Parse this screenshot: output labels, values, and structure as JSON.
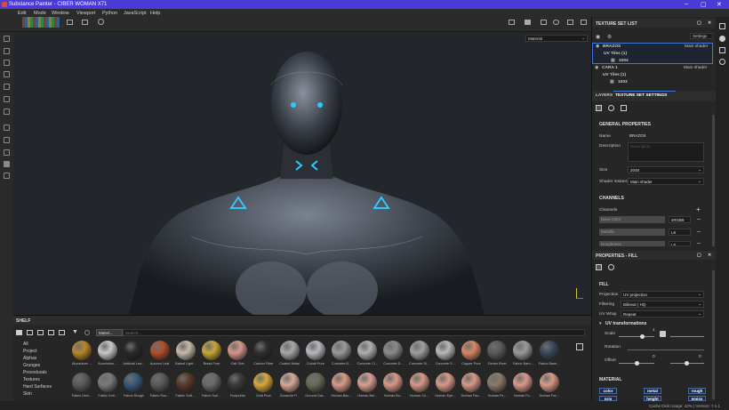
{
  "window": {
    "title": "Substance Painter - CIBER WOMAN X71"
  },
  "menu": [
    "Edit",
    "Mode",
    "Window",
    "Viewport",
    "Python",
    "JavaScript",
    "Help"
  ],
  "viewport": {
    "display_mode": "Material"
  },
  "texture_set_list": {
    "title": "TEXTURE SET LIST",
    "settings_label": "Settings",
    "sets": [
      {
        "name": "BRAZOS",
        "shader": "Main shader",
        "uv_tiles_label": "UV Tiles (1)",
        "tile": "1004"
      },
      {
        "name": "CARA 1",
        "shader": "Main shader",
        "uv_tiles_label": "UV Tiles (1)",
        "tile": "1003"
      }
    ]
  },
  "tabs": {
    "layers": "LAYERS",
    "texture_set_settings": "TEXTURE SET SETTINGS"
  },
  "general": {
    "heading": "GENERAL PROPERTIES",
    "name_label": "Name",
    "name_value": "BRAZOS",
    "description_label": "Description",
    "description_placeholder": "Description",
    "size_label": "Size",
    "size_value": "2048",
    "shader_label": "Shader instance",
    "shader_value": "Main shader"
  },
  "channels": {
    "heading": "CHANNELS",
    "label": "Channels",
    "rows": [
      {
        "name": "Base Color",
        "format": "sRGB8"
      },
      {
        "name": "Metallic",
        "format": "L8"
      },
      {
        "name": "Roughness",
        "format": "L8"
      }
    ]
  },
  "fill": {
    "title": "PROPERTIES - FILL",
    "heading": "FILL",
    "projection_label": "Projection",
    "projection_value": "UV projection",
    "filtering_label": "Filtering",
    "filtering_value": "Bilinear | HQ",
    "uvwrap_label": "UV Wrap",
    "uvwrap_value": "Repeat",
    "uvtransform_heading": "UV transformations",
    "scale_label": "Scale",
    "scale_value": "1",
    "rotation_label": "Rotation",
    "rotation_value": "0",
    "offset_label": "Offset",
    "offset_value_x": "0",
    "offset_value_y": "0",
    "material_heading": "MATERIAL",
    "material_chips": [
      "color",
      "metal",
      "rough",
      "nrm",
      "height",
      "emiss"
    ]
  },
  "shelf": {
    "title": "SHELF",
    "filter_chip": "Materi...",
    "search_placeholder": "Search...",
    "categories": [
      "All",
      "Project",
      "Alphas",
      "Grunges",
      "Procedurals",
      "Textures",
      "Hard Surfaces",
      "Skin"
    ],
    "materials_row1": [
      {
        "label": "Aluminium ...",
        "color": "#b8882a"
      },
      {
        "label": "Aluminium ...",
        "color": "#c8c8c8"
      },
      {
        "label": "Artificial Lea...",
        "color": "#2a2a2a"
      },
      {
        "label": "Autumn Leaf",
        "color": "#b0502a"
      },
      {
        "label": "Baked Light...",
        "color": "#c8b8a8"
      },
      {
        "label": "Brass Pure",
        "color": "#c8a838"
      },
      {
        "label": "Calf Skin",
        "color": "#d8968a"
      },
      {
        "label": "Carbon Fiber",
        "color": "#303030"
      },
      {
        "label": "Coated Metal",
        "color": "#a8a8a8"
      },
      {
        "label": "Cobalt Pure",
        "color": "#b8b8c0"
      },
      {
        "label": "Concrete B...",
        "color": "#9a9a9a"
      },
      {
        "label": "Concrete Cl...",
        "color": "#b0b0b0"
      },
      {
        "label": "Concrete D...",
        "color": "#8a8a8a"
      },
      {
        "label": "Concrete Si...",
        "color": "#a0a0a0"
      },
      {
        "label": "Concrete S...",
        "color": "#b8b8b8"
      },
      {
        "label": "Copper Pure",
        "color": "#d88868"
      },
      {
        "label": "Denim Rivet",
        "color": "#5a5a5a"
      },
      {
        "label": "Fabric Barn...",
        "color": "#9a9a9a"
      },
      {
        "label": "Fabric Base...",
        "color": "#3a4a5a"
      }
    ],
    "materials_row2": [
      {
        "label": "Fabric Deni...",
        "color": "#5a5a5a"
      },
      {
        "label": "Fabric Knit...",
        "color": "#7a7a7a"
      },
      {
        "label": "Fabric Rough",
        "color": "#3a5a7a"
      },
      {
        "label": "Fabric Rou...",
        "color": "#5a5a5a"
      },
      {
        "label": "Fabric Soft ...",
        "color": "#5a3a2a"
      },
      {
        "label": "Fabric Suit ...",
        "color": "#6a6a6a"
      },
      {
        "label": "Footprints",
        "color": "#3a3a3a"
      },
      {
        "label": "Gold Pure",
        "color": "#d8a838"
      },
      {
        "label": "Gouache P...",
        "color": "#d8a898"
      },
      {
        "label": "Ground Gra...",
        "color": "#6a6a5a"
      },
      {
        "label": "Human Bac...",
        "color": "#d89a88"
      },
      {
        "label": "Human Bel...",
        "color": "#d8a090"
      },
      {
        "label": "Human Bu...",
        "color": "#d89888"
      },
      {
        "label": "Human Ch...",
        "color": "#d89888"
      },
      {
        "label": "Human Eye...",
        "color": "#d89a8a"
      },
      {
        "label": "Human Fac...",
        "color": "#d89888"
      },
      {
        "label": "Human Fe...",
        "color": "#8a7a6a"
      },
      {
        "label": "Human Fo...",
        "color": "#d89a88"
      },
      {
        "label": "Human For...",
        "color": "#d89a88"
      }
    ]
  },
  "status": {
    "text": "Cache Disk Usage:  42% | Version: 7.1.1"
  },
  "colors": {
    "title_bar": "#4a3ad8",
    "accent": "#3a7ad8",
    "glow": "#2ec8ff"
  }
}
